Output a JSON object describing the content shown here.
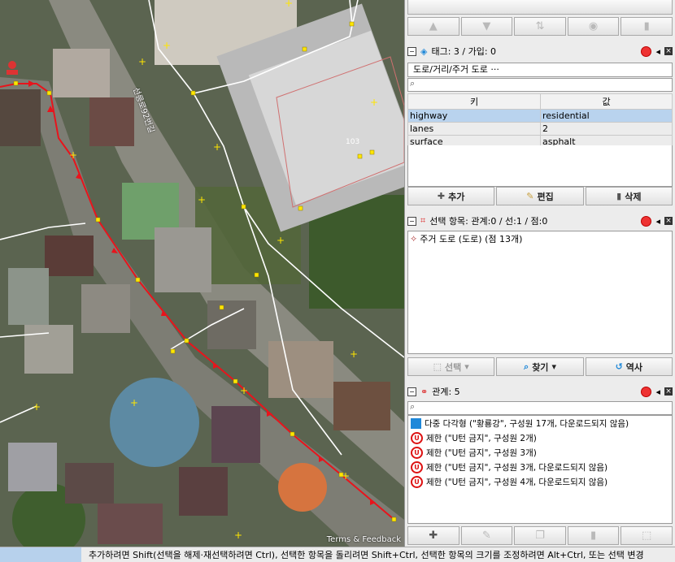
{
  "map": {
    "road_label": "선릉로92번길",
    "building_number": "103",
    "terms_link": "Terms & Feedback"
  },
  "tags_panel": {
    "title": "태그: 3 / 가입: 0",
    "preset": "도로/거리/주거 도로 ···",
    "search_placeholder": "",
    "col_key": "키",
    "col_value": "값",
    "rows": [
      {
        "key": "highway",
        "value": "residential"
      },
      {
        "key": "lanes",
        "value": "2"
      },
      {
        "key": "surface",
        "value": "asphalt"
      }
    ],
    "add_label": "추가",
    "edit_label": "편집",
    "delete_label": "삭제"
  },
  "selection_panel": {
    "title": "선택 항목: 관계:0 / 선:1 / 점:0",
    "items": [
      "주거 도로 (도로) (점 13개)"
    ],
    "select_label": "선택",
    "search_label": "찾기",
    "history_label": "역사"
  },
  "relations_panel": {
    "title": "관계: 5",
    "items": [
      {
        "icon": "multipolygon-icon",
        "text": "다중 다각형 (\"황룡강\", 구성원 17개, 다운로드되지 않음)"
      },
      {
        "icon": "no-u-turn-icon",
        "text": "제한 (\"U턴 금지\", 구성원 2개)"
      },
      {
        "icon": "no-u-turn-icon",
        "text": "제한 (\"U턴 금지\", 구성원 3개)"
      },
      {
        "icon": "no-u-turn-icon",
        "text": "제한 (\"U턴 금지\", 구성원 3개, 다운로드되지 않음)"
      },
      {
        "icon": "no-u-turn-icon",
        "text": "제한 (\"U턴 금지\", 구성원 4개, 다운로드되지 않음)"
      }
    ]
  },
  "statusbar": {
    "text": "추가하려면 Shift(선택을 해제·재선택하려면 Ctrl), 선택한 항목을 돌리려면 Shift+Ctrl, 선택한 항목의 크기를 조정하려면 Alt+Ctrl, 또는 선택 변경"
  },
  "colors": {
    "selected_way": "#e8141c",
    "way": "#ffffff",
    "node": "#ffe600",
    "accent": "#1e88d9"
  }
}
